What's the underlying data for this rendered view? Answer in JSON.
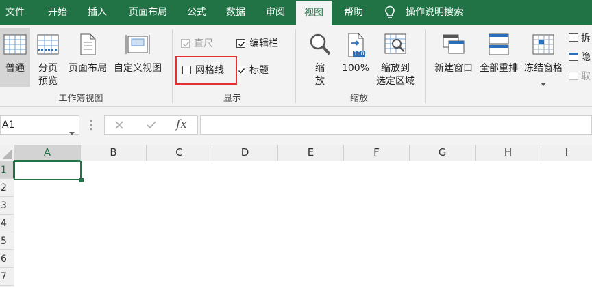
{
  "tabs": [
    {
      "label": "文件",
      "active": false
    },
    {
      "label": "开始",
      "active": false
    },
    {
      "label": "插入",
      "active": false
    },
    {
      "label": "页面布局",
      "active": false
    },
    {
      "label": "公式",
      "active": false
    },
    {
      "label": "数据",
      "active": false
    },
    {
      "label": "审阅",
      "active": false
    },
    {
      "label": "视图",
      "active": true
    },
    {
      "label": "帮助",
      "active": false
    }
  ],
  "tell_me": "操作说明搜索",
  "ribbon": {
    "workbook_views": {
      "group_label": "工作簿视图",
      "normal": "普通",
      "page_break": [
        "分页",
        "预览"
      ],
      "page_layout": "页面布局",
      "custom_views": "自定义视图"
    },
    "show": {
      "group_label": "显示",
      "ruler": {
        "label": "直尺",
        "checked": true,
        "enabled": false
      },
      "formula_bar": {
        "label": "编辑栏",
        "checked": true
      },
      "gridlines": {
        "label": "网格线",
        "checked": false
      },
      "headings": {
        "label": "标题",
        "checked": true
      }
    },
    "zoom": {
      "group_label": "缩放",
      "zoom": [
        "缩",
        "放"
      ],
      "hundred": "100%",
      "zoom_selection": [
        "缩放到",
        "选定区域"
      ],
      "icon_text": "100"
    },
    "window": {
      "new_window": "新建窗口",
      "arrange_all": "全部重排",
      "freeze_panes": "冻结窗格",
      "split": "拆",
      "hide": "隐",
      "unhide": "取"
    }
  },
  "formula_bar": {
    "name_box": "A1",
    "fx": "fx"
  },
  "grid": {
    "columns": [
      "A",
      "B",
      "C",
      "D",
      "E",
      "F",
      "G",
      "H",
      "I"
    ],
    "rows": [
      "1",
      "2",
      "3",
      "4",
      "5",
      "6",
      "7"
    ],
    "active_cell": "A1"
  },
  "colors": {
    "accent": "#217346",
    "highlight": "#e03030"
  }
}
